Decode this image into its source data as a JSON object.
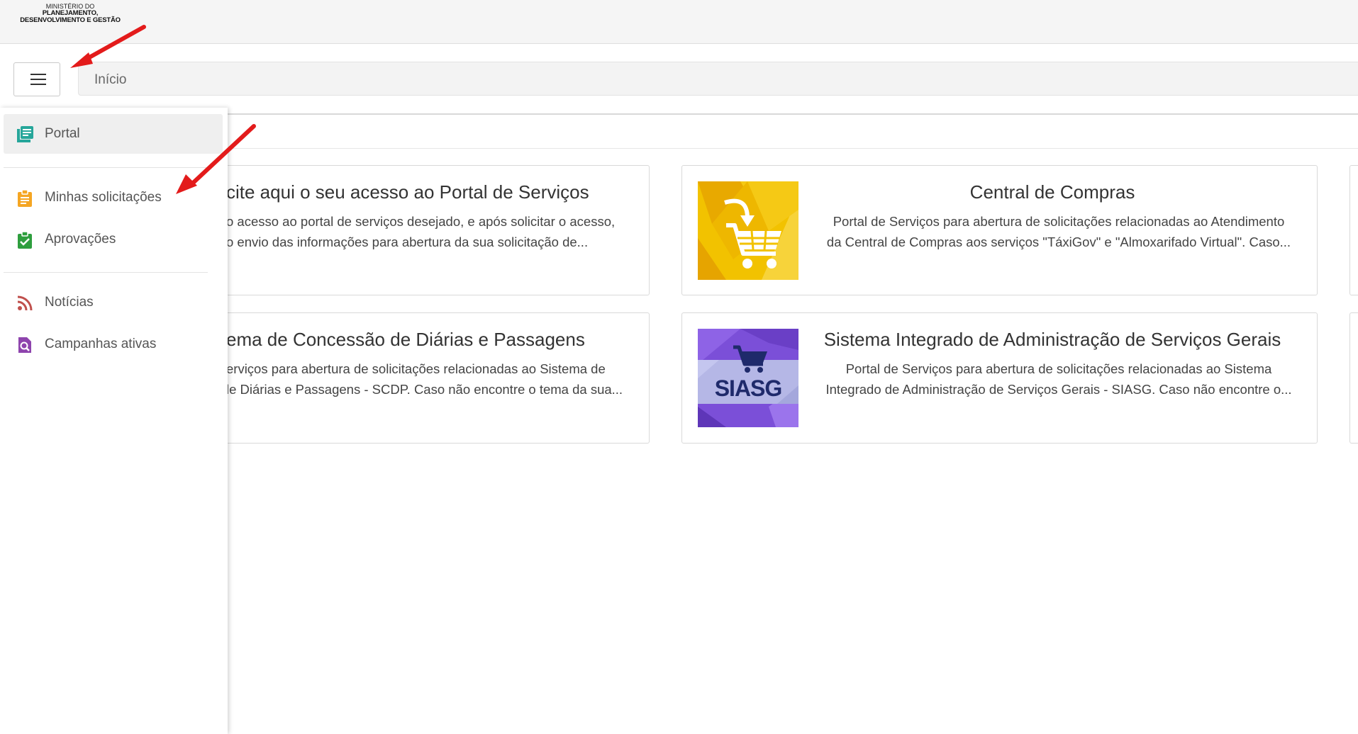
{
  "header": {
    "logo_line1": "MINISTÉRIO DO",
    "logo_line2": "PLANEJAMENTO,",
    "logo_line3": "DESENVOLVIMENTO E GESTÃO"
  },
  "toolbar": {
    "menu_icon": "hamburger-menu-icon",
    "breadcrumb": "Início"
  },
  "sidebar": {
    "items": [
      {
        "label": "Portal",
        "icon": "portal-icon",
        "color": "#26a69a"
      },
      {
        "label": "Minhas solicitações",
        "icon": "clipboard-icon",
        "color": "#f5a623"
      },
      {
        "label": "Aprovações",
        "icon": "clipboard-check-icon",
        "color": "#2e9e3e"
      },
      {
        "label": "Notícias",
        "icon": "rss-icon",
        "color": "#c0504d"
      },
      {
        "label": "Campanhas ativas",
        "icon": "campaign-search-icon",
        "color": "#8e44ad"
      }
    ]
  },
  "cards": [
    {
      "title": "cite aqui o seu acesso ao Portal de Serviços",
      "desc_line1": "o acesso ao portal de serviços desejado, e após solicitar o acesso,",
      "desc_line2": "o envio das informações para abertura da sua solicitação de..."
    },
    {
      "title": "Central de Compras",
      "desc_line1": "Portal de Serviços para abertura de solicitações relacionadas ao Atendimento",
      "desc_line2": "da Central de Compras aos serviços \"TáxiGov\" e \"Almoxarifado Virtual\". Caso...",
      "image": "shopping-cart-image"
    },
    {
      "title": "ema de Concessão de Diárias e Passagens",
      "desc_line1": "erviços para abertura de solicitações relacionadas ao Sistema de",
      "desc_line2": "le Diárias e Passagens - SCDP. Caso não encontre o tema da sua...",
      "image": ""
    },
    {
      "title": "Sistema Integrado de Administração de Serviços Gerais",
      "desc_line1": "Portal de Serviços para abertura de solicitações relacionadas ao Sistema",
      "desc_line2": "Integrado de Administração de Serviços Gerais - SIASG. Caso não encontre o...",
      "image": "siasg-image",
      "image_text": "SIASG"
    }
  ],
  "colors": {
    "arrow": "#e31b1b",
    "cart_bg": "#f2c200",
    "siasg_bg": "#7b4fd8"
  }
}
